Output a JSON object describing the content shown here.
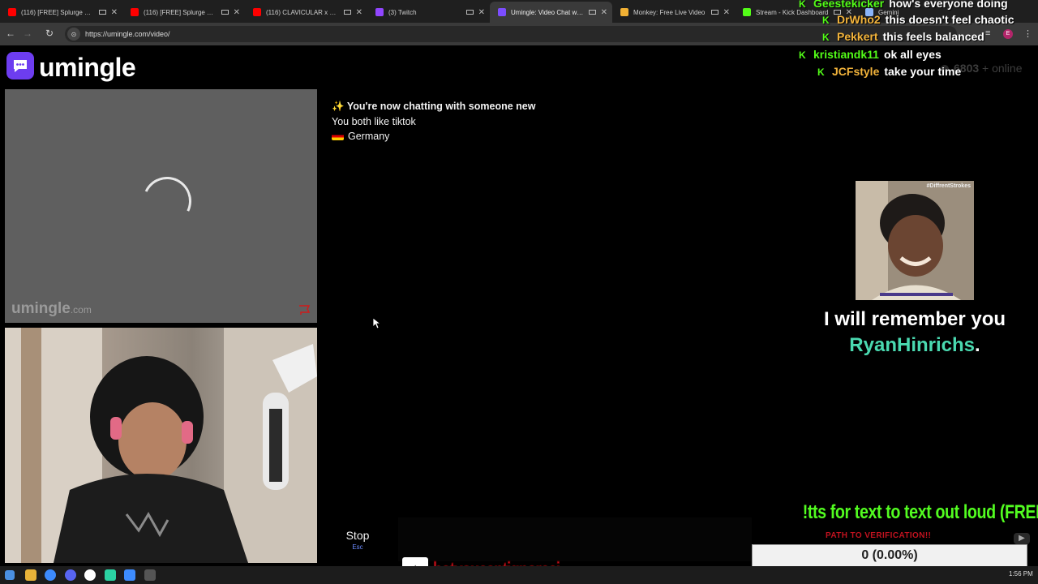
{
  "browser": {
    "tabs": [
      {
        "title": "(116) [FREE] Splurge Type",
        "favicon": "youtube-icon",
        "color": "#ff0000",
        "active": false
      },
      {
        "title": "(116) [FREE] Splurge Type",
        "favicon": "youtube-icon",
        "color": "#ff0000",
        "active": false
      },
      {
        "title": "(116) CLAVICULAR x HSTIKK",
        "favicon": "youtube-icon",
        "color": "#ff0000",
        "active": false
      },
      {
        "title": "(3) Twitch",
        "favicon": "twitch-icon",
        "color": "#9146ff",
        "active": false
      },
      {
        "title": "Umingle: Video Chat with",
        "favicon": "umingle-icon",
        "color": "#7c4dff",
        "active": true
      },
      {
        "title": "Monkey: Free Live Video",
        "favicon": "monkey-icon",
        "color": "#f2b134",
        "active": false
      },
      {
        "title": "Stream - Kick Dashboard",
        "favicon": "kick-icon",
        "color": "#53fc18",
        "active": false
      },
      {
        "title": "Gemini",
        "favicon": "gemini-icon",
        "color": "#8ab4f8",
        "active": false
      }
    ],
    "url": "https://umingle.com/video/",
    "profile_initial": "E"
  },
  "site": {
    "logo_text": "umingle",
    "online_count": "6803",
    "online_suffix": "+ online",
    "watermark": "umingle",
    "watermark_suffix": ".com"
  },
  "chat": {
    "messages": [
      {
        "icon": "✨",
        "text": "You're now chatting with someone new",
        "style": "bold"
      },
      {
        "text": "You both like tiktok",
        "style": "normal"
      },
      {
        "flag": "germany-flag",
        "text": "Germany",
        "style": "normal"
      }
    ],
    "stop_label": "Stop",
    "stop_key": "Esc",
    "input_placeholder": ""
  },
  "stream_overlay": {
    "chat": [
      {
        "user": "Geestekicker",
        "message": "how's everyone doing",
        "color": "#53fc18"
      },
      {
        "user": "DrWho2",
        "message": "this doesn't feel chaotic",
        "color": "#f3b43b"
      },
      {
        "user": "Pekkert",
        "message": "this feels balanced",
        "color": "#f3b43b"
      },
      {
        "user": "kristiandk11",
        "message": "ok all eyes",
        "color": "#53fc18"
      },
      {
        "user": "JCFstyle",
        "message": "take your time",
        "color": "#f3b43b"
      }
    ],
    "meme_tag": "#DiffrentStrokes",
    "meme_caption": "I will remember you",
    "meme_name": "RyanHinrichs",
    "meme_name_suffix": ".",
    "tts_text": "!tts for text to text out loud (FREE)",
    "tts_sub": "PATH TO VERIFICATION!!",
    "goal_text": "0 (0.00%)",
    "goal_progress": 0,
    "tiktok_handle": "botyoucantignoreej"
  },
  "taskbar": {
    "time": "1:56 PM"
  }
}
